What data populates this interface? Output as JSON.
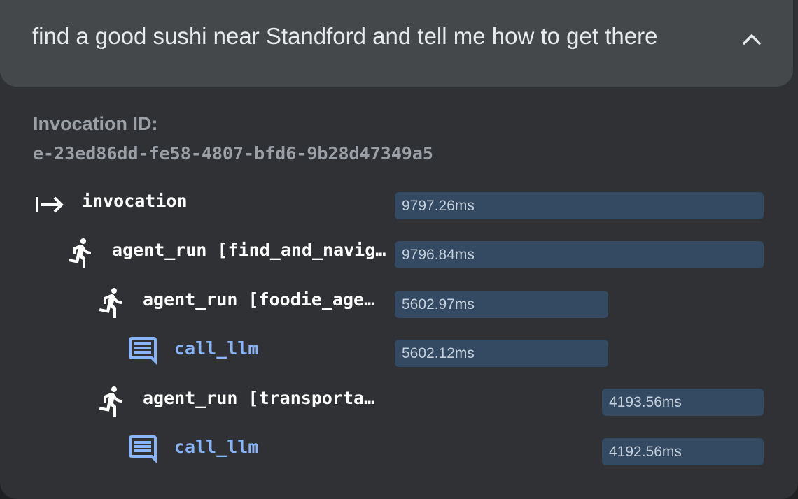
{
  "header": {
    "query": "find a good sushi near Standford and tell me how to get there",
    "collapse_icon": "chevron-up-icon"
  },
  "invocation": {
    "label": "Invocation ID:",
    "id": "e-23ed86dd-fe58-4807-bfd6-9b28d47349a5"
  },
  "trace": {
    "rows": [
      {
        "icon": "start-arrow-icon",
        "label": "invocation",
        "duration": "9797.26ms"
      },
      {
        "icon": "running-person-icon",
        "label": "agent_run [find_and_navigate_agent]",
        "duration": "9796.84ms"
      },
      {
        "icon": "running-person-icon",
        "label": "agent_run [foodie_agent]",
        "duration": "5602.97ms"
      },
      {
        "icon": "chat-message-icon",
        "label": "call_llm",
        "duration": "5602.12ms"
      },
      {
        "icon": "running-person-icon",
        "label": "agent_run [transportation_agent]",
        "duration": "4193.56ms"
      },
      {
        "icon": "chat-message-icon",
        "label": "call_llm",
        "duration": "4192.56ms"
      }
    ]
  }
}
